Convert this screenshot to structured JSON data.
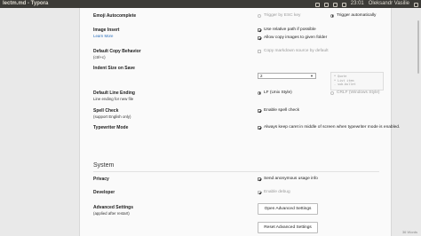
{
  "window": {
    "title": "lectm.md - Typora"
  },
  "tray": {
    "time": "23:01",
    "user": "Oleksandr Vasilie"
  },
  "statusbar": {
    "words": "36 Words"
  },
  "settings": {
    "emoji": {
      "label": "Emoji Autocomplete",
      "opt1": "Trigger by ESC key",
      "opt2": "Trigger automatically"
    },
    "image": {
      "label": "Image Insert",
      "learn_more": "Learn More",
      "opt1": "Use relative path if possible",
      "opt2": "Allow copy images to given folder"
    },
    "copy": {
      "label": "Default Copy Behavior",
      "shortcut": "(ctrl+c)",
      "opt1": "Copy markdown source by default"
    },
    "indent": {
      "label": "Indent Size on Save",
      "value": "2",
      "preview": [
        "* Quote",
        "  * List item",
        "    - sub-bullet"
      ]
    },
    "line_ending": {
      "label": "Default Line Ending",
      "sub": "Line ending for new file",
      "opt1": "LF (Unix Style)",
      "opt2": "CRLF (Windows Style)"
    },
    "spell": {
      "label": "Spell Check",
      "sub": "(support English only)",
      "opt1": "Enable spell check"
    },
    "typewriter": {
      "label": "Typewriter Mode",
      "opt1": "Always keep caret in middle of screen when typewriter mode is enabled."
    },
    "system": {
      "title": "System"
    },
    "privacy": {
      "label": "Privacy",
      "opt1": "Send anonymous usage info"
    },
    "developer": {
      "label": "Developer",
      "opt1": "Enable debug"
    },
    "advanced": {
      "label": "Advanced Settings",
      "sub": "(applied after restart)",
      "open_btn": "Open Advanced Settings",
      "reset_btn": "Reset Advanced Settings"
    }
  }
}
